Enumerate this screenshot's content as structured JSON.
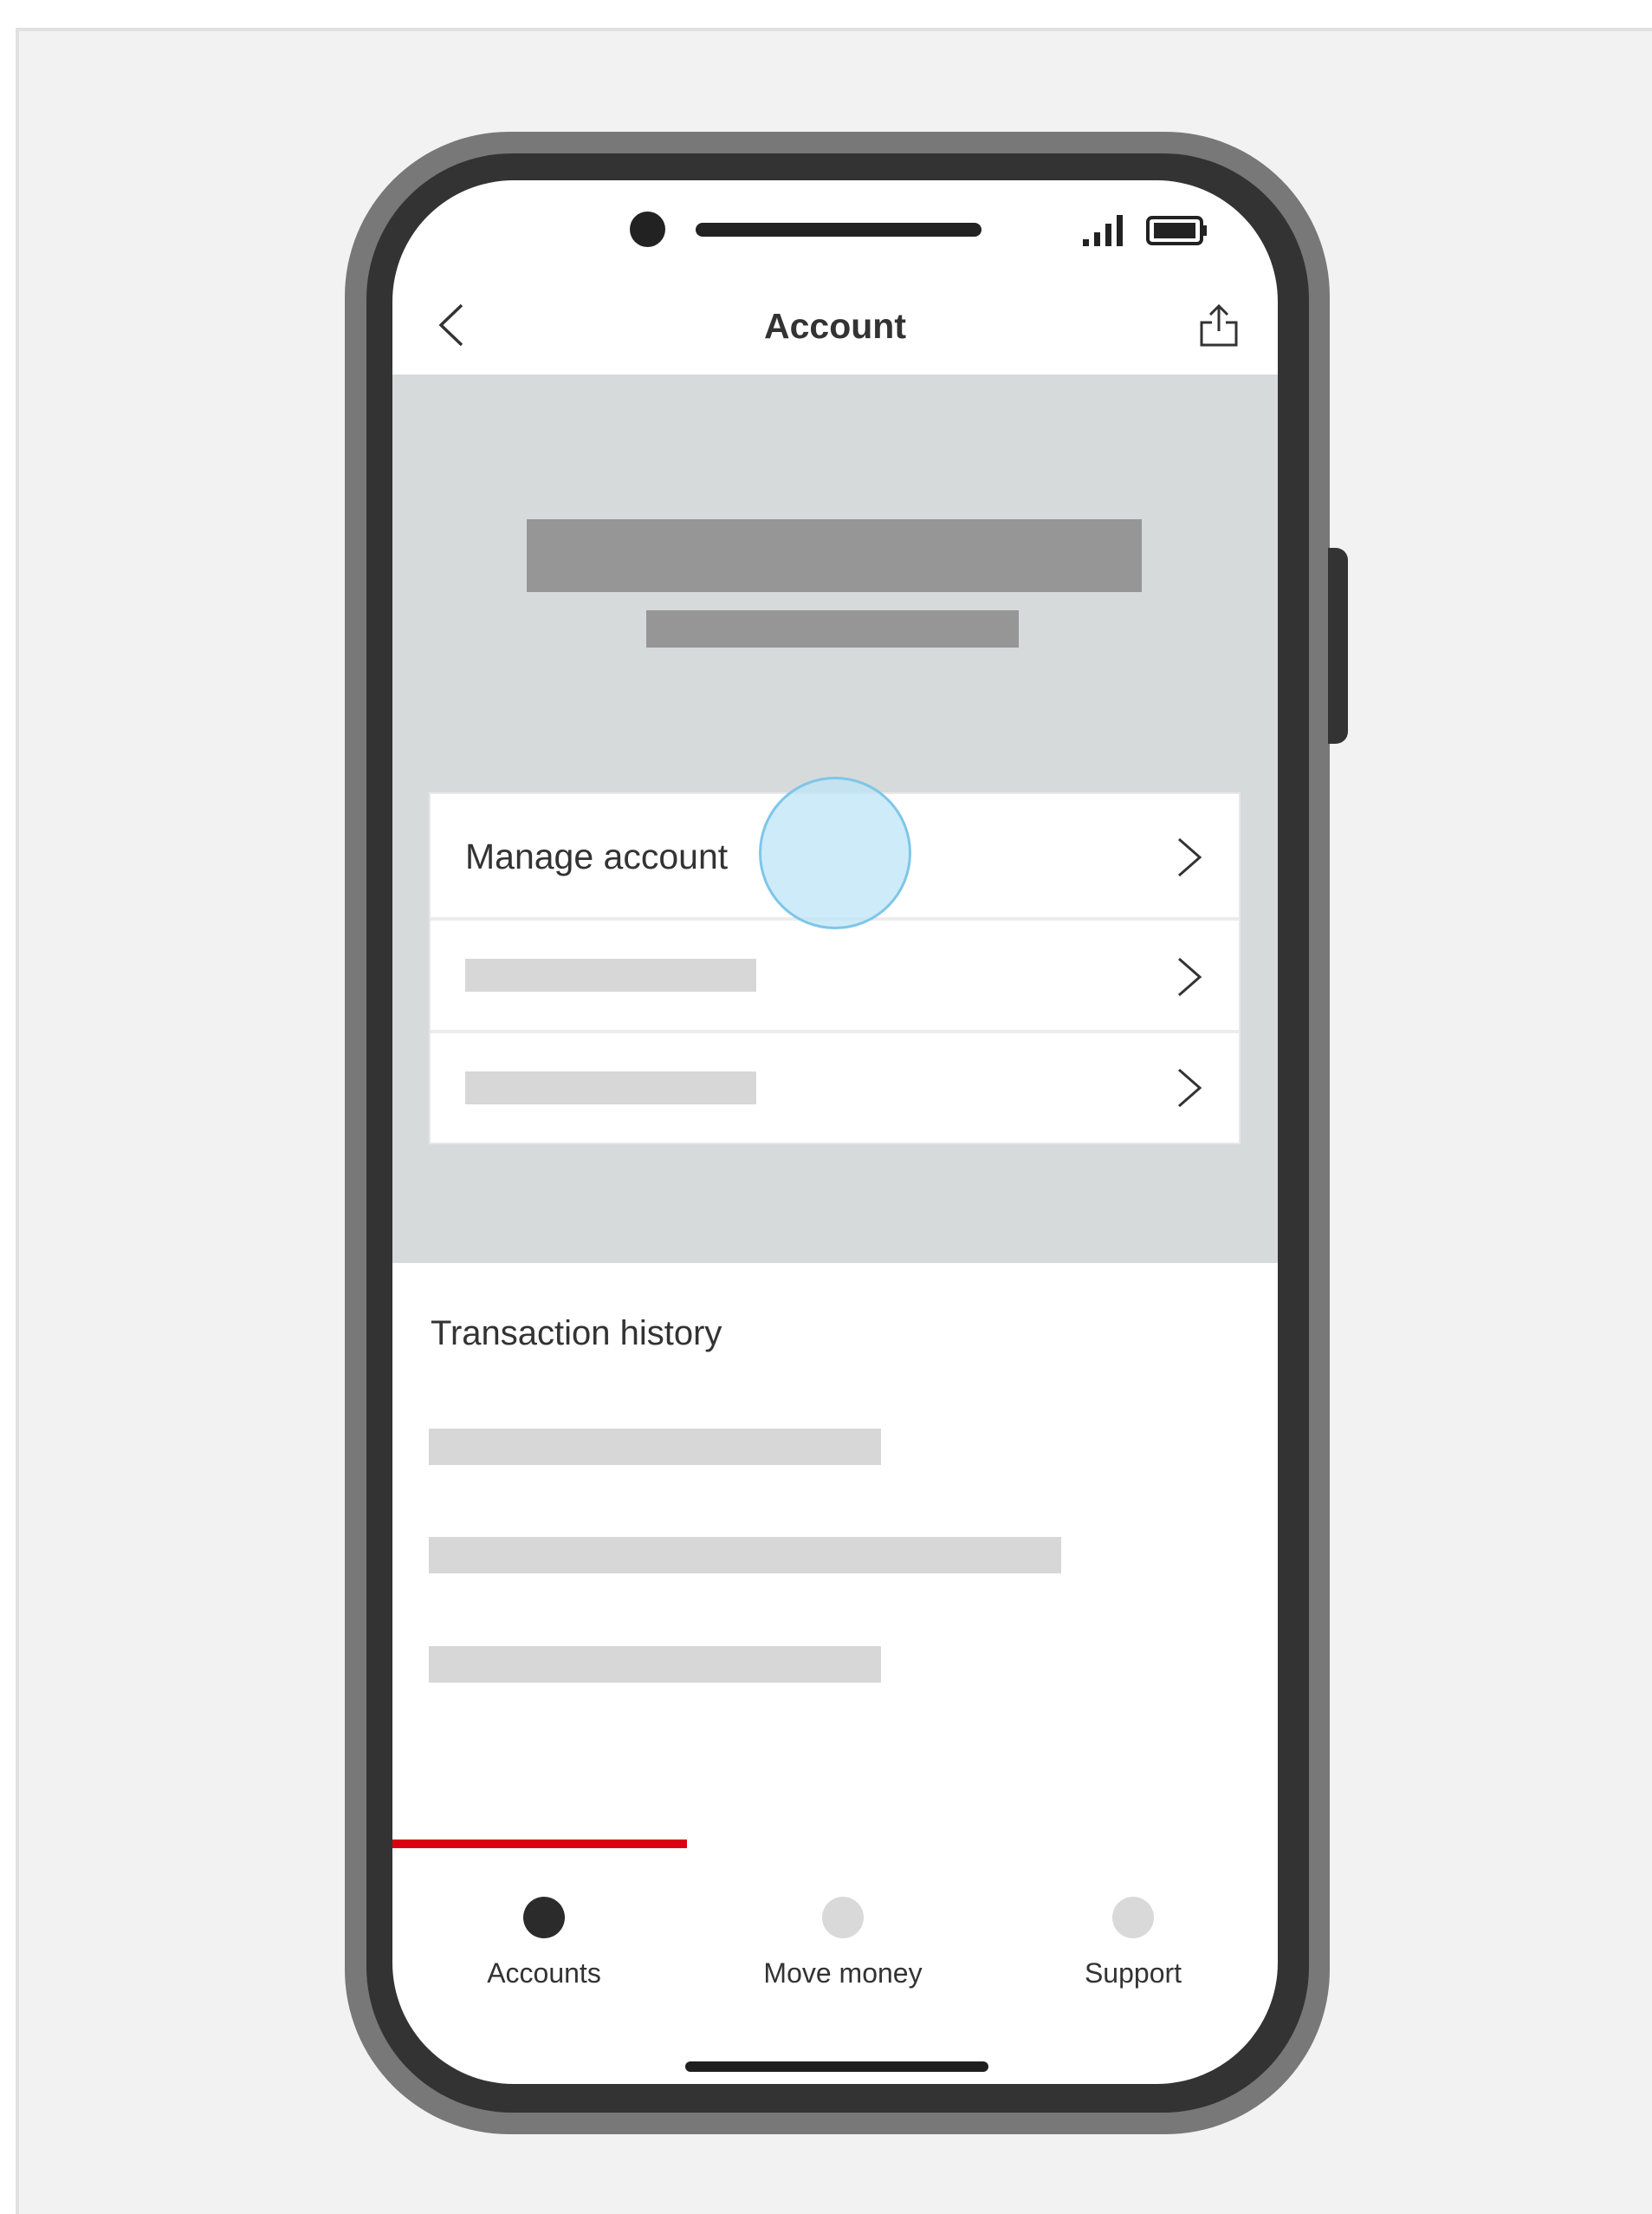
{
  "header": {
    "title": "Account",
    "back_icon": "chevron-left-icon",
    "share_icon": "share-icon"
  },
  "status_bar": {
    "icons": [
      "camera-dot",
      "signal-icon",
      "battery-icon"
    ]
  },
  "account_menu": {
    "items": [
      {
        "label": "Manage account",
        "icon": "chevron-right-icon"
      },
      {
        "label": "",
        "icon": "chevron-right-icon"
      },
      {
        "label": "",
        "icon": "chevron-right-icon"
      }
    ]
  },
  "transactions": {
    "title": "Transaction history"
  },
  "tab_bar": {
    "tabs": [
      {
        "label": "Accounts",
        "active": true
      },
      {
        "label": "Move money",
        "active": false
      },
      {
        "label": "Support",
        "active": false
      }
    ]
  },
  "colors": {
    "accent": "#db0011",
    "panel_bg": "#d7dadb",
    "placeholder_dark": "#969696",
    "placeholder_light": "#d7d7d7",
    "tap_indicator": "#cdeaf8"
  }
}
